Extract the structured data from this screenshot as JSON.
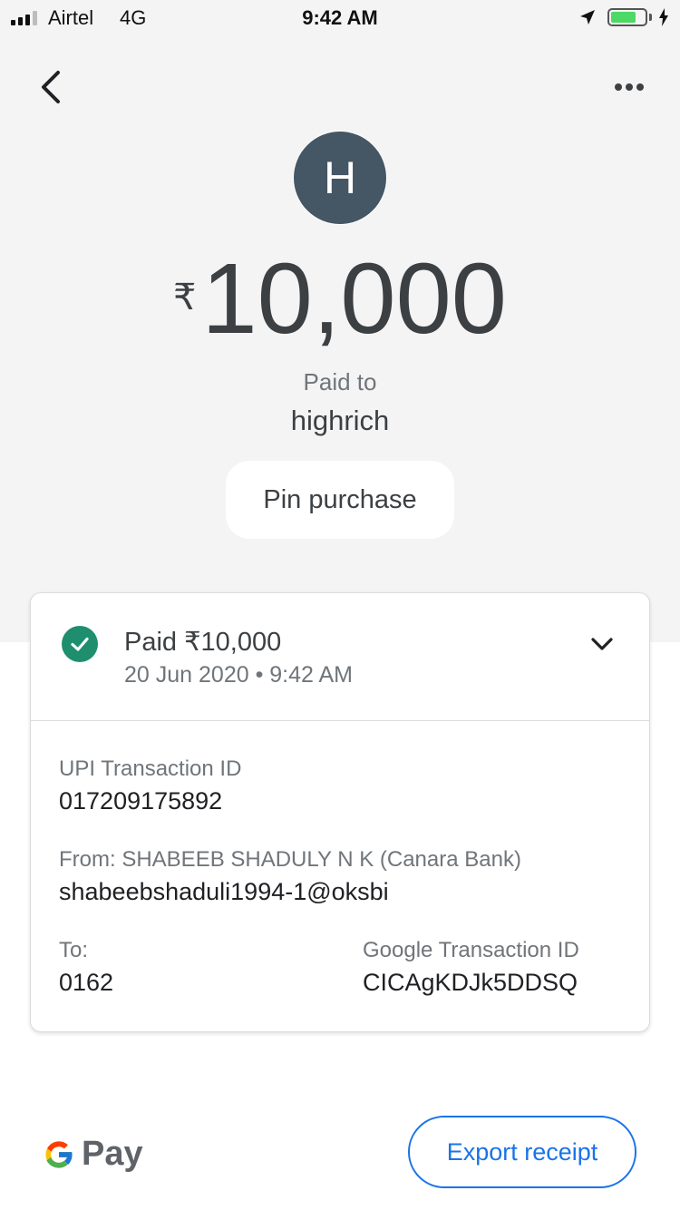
{
  "status_bar": {
    "carrier": "Airtel",
    "network": "4G",
    "time": "9:42 AM",
    "battery_level": 0.75,
    "battery_color": "#4cd964"
  },
  "header": {
    "back_icon": "chevron-left-icon",
    "more_icon": "more-horizontal-icon"
  },
  "payment": {
    "avatar_initial": "H",
    "avatar_color": "#455664",
    "currency_symbol": "₹",
    "amount": "10,000",
    "paid_to_label": "Paid to",
    "payee": "highrich",
    "pin_button": "Pin purchase"
  },
  "details_card": {
    "status_icon": "check-circle-icon",
    "status_color": "#1e8e6e",
    "status_title": "Paid ₹10,000",
    "status_date": "20 Jun 2020 • 9:42 AM",
    "upi_label": "UPI Transaction ID",
    "upi_value": "017209175892",
    "from_label": "From: SHABEEB SHADULY N K (Canara Bank)",
    "from_value": "shabeebshaduli1994-1@oksbi",
    "to_label": "To:",
    "to_value": "0162",
    "google_id_label": "Google Transaction ID",
    "google_id_value": "CICAgKDJk5DDSQ"
  },
  "footer": {
    "brand": "Pay",
    "export_button": "Export receipt",
    "accent_color": "#1a73e8"
  }
}
